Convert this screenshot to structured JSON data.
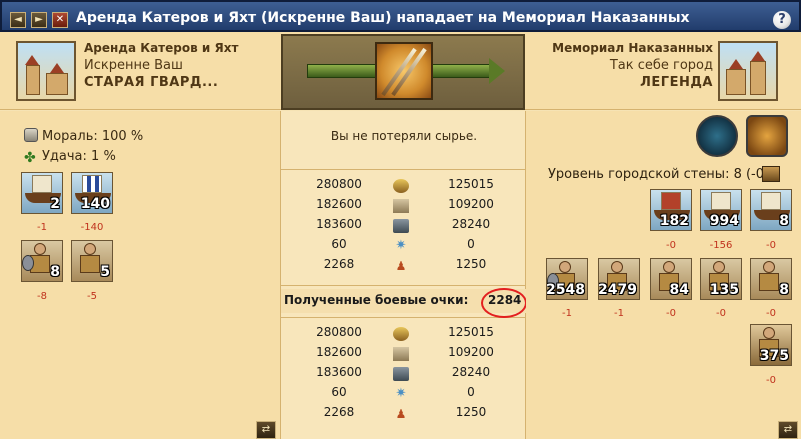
{
  "window": {
    "title": "Аренда Катеров и Яхт (Искренне Ваш) нападает на Мемориал Наказанных",
    "buttons": {
      "back": "◄",
      "forward": "►",
      "close": "✕",
      "help": "?"
    }
  },
  "attacker": {
    "town": "Аренда Катеров и Яхт",
    "player": "Искренне Ваш",
    "rank": "СТАРАЯ ГВАРД...",
    "morale": "Мораль: 100 %",
    "luck": "Удача: 1 %",
    "units": [
      {
        "kind": "transport-ship",
        "count": "2",
        "loss": "-1"
      },
      {
        "kind": "fast-transport-ship",
        "count": "140",
        "loss": "-140"
      },
      {
        "kind": "hoplite",
        "count": "8",
        "loss": "-8"
      },
      {
        "kind": "swordsman",
        "count": "5",
        "loss": "-5"
      }
    ]
  },
  "defender": {
    "town": "Мемориал Наказанных",
    "player": "Так себе город",
    "rank": "ЛЕГЕНДА",
    "wall": "Уровень городской стены: 8 (-0)",
    "units": [
      {
        "kind": "fire-ship",
        "count": "182",
        "loss": "-0"
      },
      {
        "kind": "bireme",
        "count": "994",
        "loss": "-156"
      },
      {
        "kind": "transport-ship",
        "count": "8",
        "loss": "-0"
      },
      {
        "kind": "hoplite",
        "count": "2548",
        "loss": "-1"
      },
      {
        "kind": "archer",
        "count": "2479",
        "loss": "-1"
      },
      {
        "kind": "slinger",
        "count": "84",
        "loss": "-0"
      },
      {
        "kind": "horseman",
        "count": "135",
        "loss": "-0"
      },
      {
        "kind": "chariot",
        "count": "8",
        "loss": "-0"
      },
      {
        "kind": "militia",
        "count": "375",
        "loss": "-0"
      }
    ]
  },
  "report": {
    "resources_text": "Вы не потеряли сырье.",
    "battle_points_label": "Полученные боевые очки:",
    "battle_points_value": "2284",
    "table1": [
      {
        "left": "280800",
        "icon": "wood-icon",
        "right": "125015"
      },
      {
        "left": "182600",
        "icon": "stone-icon",
        "right": "109200"
      },
      {
        "left": "183600",
        "icon": "silver-icon",
        "right": "28240"
      },
      {
        "left": "60",
        "icon": "favor-icon",
        "right": "0"
      },
      {
        "left": "2268",
        "icon": "population-icon",
        "right": "1250"
      }
    ],
    "table2": [
      {
        "left": "280800",
        "icon": "wood-icon",
        "right": "125015"
      },
      {
        "left": "182600",
        "icon": "stone-icon",
        "right": "109200"
      },
      {
        "left": "183600",
        "icon": "silver-icon",
        "right": "28240"
      },
      {
        "left": "60",
        "icon": "favor-icon",
        "right": "0"
      },
      {
        "left": "2268",
        "icon": "population-icon",
        "right": "1250"
      }
    ]
  },
  "colors": {
    "title_bar": "#2b4a7f",
    "panel": "#f6dea8",
    "loss": "#c0321d",
    "highlight_circle": "#e31f1f"
  }
}
